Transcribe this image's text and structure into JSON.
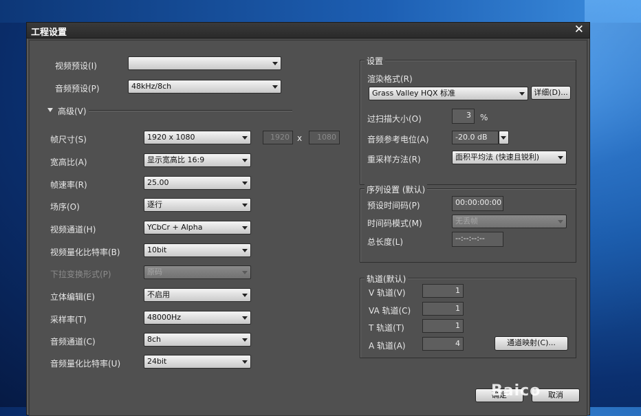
{
  "dialog": {
    "title": "工程设置",
    "close_symbol": "✕"
  },
  "left": {
    "video_preset": {
      "label": "视频预设(I)",
      "value": ""
    },
    "audio_preset": {
      "label": "音频预设(P)",
      "value": "48kHz/8ch"
    },
    "advanced_label": "高级(V)",
    "frame_size": {
      "label": "帧尺寸(S)",
      "value": "1920 x 1080",
      "width": "1920",
      "x": "x",
      "height": "1080"
    },
    "aspect": {
      "label": "宽高比(A)",
      "value": "显示宽高比 16:9"
    },
    "frame_rate": {
      "label": "帧速率(R)",
      "value": "25.00"
    },
    "field_order": {
      "label": "场序(O)",
      "value": "逐行"
    },
    "video_channel": {
      "label": "视频通道(H)",
      "value": "YCbCr + Alpha"
    },
    "video_bit": {
      "label": "视频量化比特率(B)",
      "value": "10bit"
    },
    "pulldown": {
      "label": "下拉变换形式(P)",
      "value": "原码"
    },
    "stereo": {
      "label": "立体编辑(E)",
      "value": "不启用"
    },
    "sample_rate": {
      "label": "采样率(T)",
      "value": "48000Hz"
    },
    "audio_channel": {
      "label": "音频通道(C)",
      "value": "8ch"
    },
    "audio_bit": {
      "label": "音频量化比特率(U)",
      "value": "24bit"
    }
  },
  "settings": {
    "group_title": "设置",
    "render_format_label": "渲染格式(R)",
    "render_format_value": "Grass Valley HQX 标准",
    "detail_button": "详细(D)...",
    "overscan_label": "过扫描大小(O)",
    "overscan_value": "3",
    "overscan_unit": "%",
    "audio_ref_label": "音频参考电位(A)",
    "audio_ref_value": "-20.0 dB",
    "resample_label": "重采样方法(R)",
    "resample_value": "面积平均法 (快速且锐利)"
  },
  "sequence": {
    "group_title": "序列设置 (默认)",
    "preset_tc_label": "预设时间码(P)",
    "preset_tc_value": "00:00:00:00",
    "tc_mode_label": "时间码模式(M)",
    "tc_mode_value": "无丢帧",
    "total_length_label": "总长度(L)",
    "total_length_value": "--:--:--:--"
  },
  "tracks": {
    "group_title": "轨道(默认)",
    "v_label": "V 轨道(V)",
    "v_value": "1",
    "va_label": "VA 轨道(C)",
    "va_value": "1",
    "t_label": "T 轨道(T)",
    "t_value": "1",
    "a_label": "A 轨道(A)",
    "a_value": "4",
    "mapping_button": "通道映射(C)..."
  },
  "footer": {
    "ok_label": "确定",
    "cancel_label": "取消",
    "watermark": "Baico"
  }
}
